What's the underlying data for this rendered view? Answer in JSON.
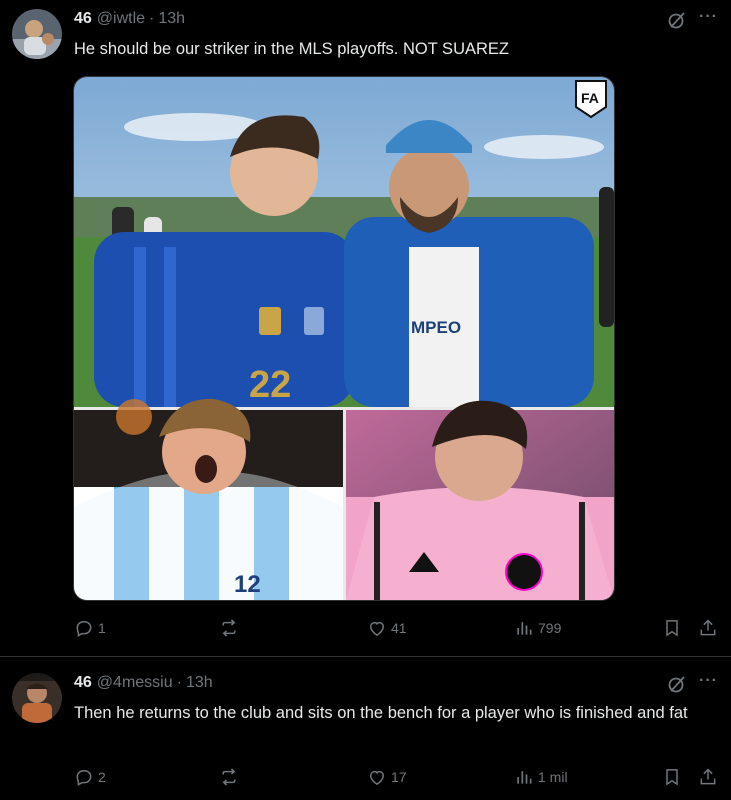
{
  "posts": [
    {
      "name": "46",
      "handle": "@iwtle",
      "separator": "·",
      "time": "13h",
      "text": "He should be our striker in the MLS playoffs. NOT SUAREZ",
      "media": {
        "badge": "FA",
        "jersey_number_top": "22",
        "shirt_text": "MPEO",
        "jersey_number_bottom": "12"
      },
      "stats": {
        "replies": "1",
        "reposts": "",
        "likes": "41",
        "views": "799"
      }
    },
    {
      "name": "46",
      "handle": "@4messiu",
      "separator": "·",
      "time": "13h",
      "text": "Then he returns to the club and sits on the bench for a player who is finished and fat",
      "stats": {
        "replies": "2",
        "reposts": "",
        "likes": "17",
        "views": "1 mil"
      }
    }
  ],
  "colors": {
    "background": "#000000",
    "text_primary": "#e7e9ea",
    "text_secondary": "#71767b",
    "divider": "#2f3336"
  },
  "icons": [
    "avatar",
    "grok-icon",
    "more-icon",
    "reply-icon",
    "repost-icon",
    "like-icon",
    "views-icon",
    "bookmark-icon",
    "share-icon"
  ]
}
